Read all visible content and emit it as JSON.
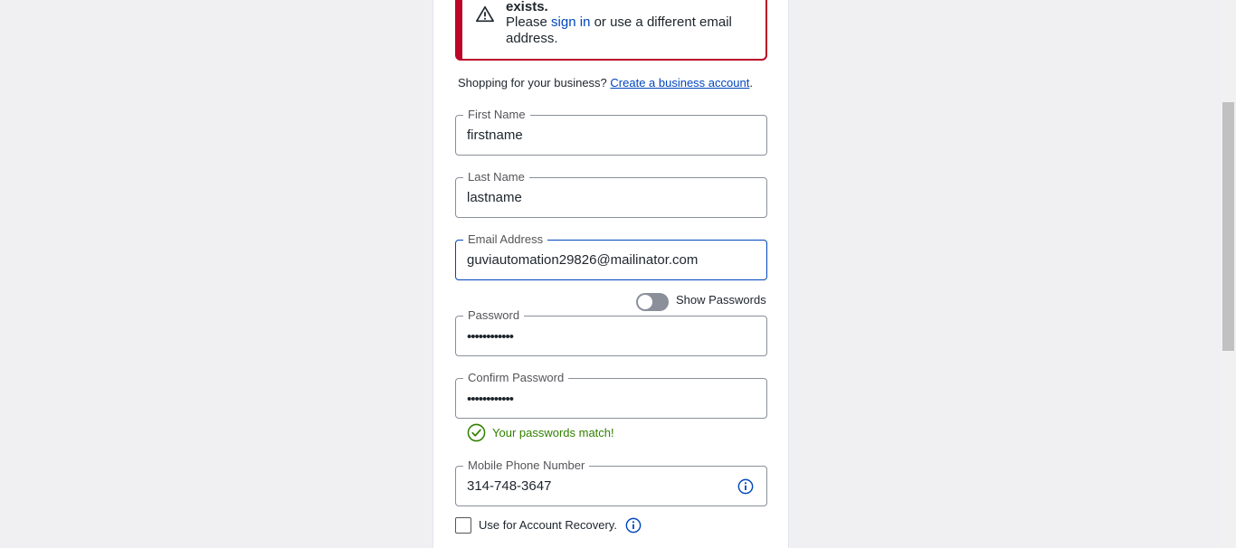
{
  "alert": {
    "title": "exists.",
    "body_prefix": "Please",
    "link_text": "sign in",
    "body_suffix": "or use a different email address.",
    "icon": "warning-triangle-icon",
    "color": "#bb0628"
  },
  "business": {
    "prompt": "Shopping for your business?",
    "link_text": "Create a business account",
    "suffix": "."
  },
  "form": {
    "first_name": {
      "label": "First Name",
      "value": "firstname"
    },
    "last_name": {
      "label": "Last Name",
      "value": "lastname"
    },
    "email": {
      "label": "Email Address",
      "value": "guviautomation29826@mailinator.com"
    },
    "show_passwords": {
      "label": "Show Passwords",
      "on": false
    },
    "password": {
      "label": "Password",
      "masked": "••••••••••••"
    },
    "confirm_password": {
      "label": "Confirm Password",
      "masked": "••••••••••••"
    },
    "password_match": {
      "text": "Your passwords match!",
      "icon": "check-circle-icon",
      "color": "#318000"
    },
    "phone": {
      "label": "Mobile Phone Number",
      "value": "314-748-3647",
      "icon": "info-icon"
    },
    "account_recovery": {
      "label": "Use for Account Recovery.",
      "checked": false,
      "icon": "info-icon"
    }
  },
  "colors": {
    "link": "#0046be",
    "error": "#bb0628",
    "success": "#318000"
  }
}
